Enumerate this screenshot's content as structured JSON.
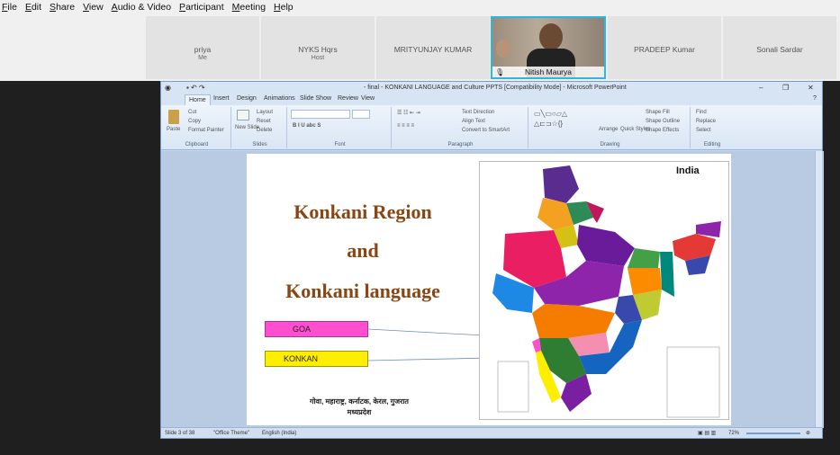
{
  "menu": [
    "File",
    "Edit",
    "Share",
    "View",
    "Audio & Video",
    "Participant",
    "Meeting",
    "Help"
  ],
  "participants": [
    {
      "name": "priya",
      "role": "Me"
    },
    {
      "name": "NYKS Hqrs",
      "role": "Host"
    },
    {
      "name": "MRITYUNJAY KUMAR",
      "role": ""
    },
    {
      "name": "Nitish Maurya",
      "role": "",
      "video": true
    },
    {
      "name": "PRADEEP Kumar",
      "role": ""
    },
    {
      "name": "Sonali Sardar",
      "role": ""
    }
  ],
  "ppt": {
    "window_title": "- final - KONKANI LANGUAGE and Culture PPTS [Compatibility Mode] - Microsoft PowerPoint",
    "tabs": [
      "Home",
      "Insert",
      "Design",
      "Animations",
      "Slide Show",
      "Review",
      "View"
    ],
    "groups": [
      "Clipboard",
      "Slides",
      "Font",
      "Paragraph",
      "Drawing",
      "Editing"
    ],
    "clipboard": {
      "paste": "Paste",
      "cut": "Cut",
      "copy": "Copy",
      "format_painter": "Format Painter"
    },
    "slides_grp": {
      "new_slide": "New Slide",
      "layout": "Layout",
      "reset": "Reset",
      "delete": "Delete"
    },
    "paragraph": {
      "text_direction": "Text Direction",
      "align_text": "Align Text",
      "smartart": "Convert to SmartArt"
    },
    "drawing": {
      "arrange": "Arrange",
      "quick_styles": "Quick Styles",
      "shape_fill": "Shape Fill",
      "shape_outline": "Shape Outline",
      "shape_effects": "Shape Effects"
    },
    "editing": {
      "find": "Find",
      "replace": "Replace",
      "select": "Select"
    },
    "status": {
      "slide": "Slide 3 of 38",
      "theme": "\"Office Theme\"",
      "language": "English (India)",
      "zoom": "72%"
    }
  },
  "slide": {
    "title_lines": [
      "Konkani Region",
      "and",
      "Konkani language"
    ],
    "box_goa": "GOA",
    "box_konkan": "KONKAN",
    "devanagari_lines": [
      "गोवा, महाराष्ट्र, कर्नाटक, केरल, गुजरात",
      "मध्यप्रदेश"
    ],
    "map_label": "India"
  },
  "colors": {
    "video_border": "#2ab7e6",
    "title_color": "#8b4513",
    "goa": "#ff4fd0",
    "konkan": "#ffee00"
  }
}
